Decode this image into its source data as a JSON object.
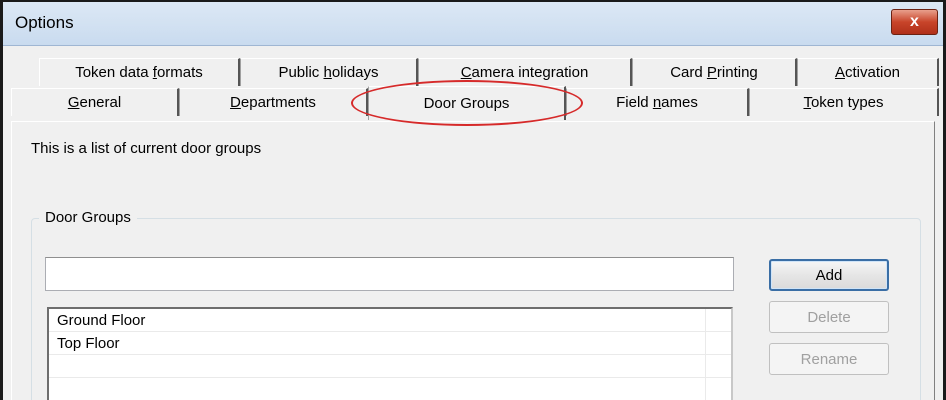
{
  "window": {
    "title": "Options",
    "close_glyph": "x"
  },
  "tabs_row1": [
    {
      "prefix": "Token data ",
      "mnemonic": "f",
      "suffix": "ormats"
    },
    {
      "prefix": "Public ",
      "mnemonic": "h",
      "suffix": "olidays"
    },
    {
      "prefix": "",
      "mnemonic": "C",
      "suffix": "amera integration"
    },
    {
      "prefix": "Card ",
      "mnemonic": "P",
      "suffix": "rinting"
    },
    {
      "prefix": "",
      "mnemonic": "A",
      "suffix": "ctivation"
    }
  ],
  "tabs_row2": [
    {
      "prefix": "",
      "mnemonic": "G",
      "suffix": "eneral"
    },
    {
      "prefix": "",
      "mnemonic": "D",
      "suffix": "epartments"
    },
    {
      "prefix": "Door Groups",
      "mnemonic": "",
      "suffix": ""
    },
    {
      "prefix": "Field ",
      "mnemonic": "n",
      "suffix": "ames"
    },
    {
      "prefix": "",
      "mnemonic": "T",
      "suffix": "oken types"
    }
  ],
  "content": {
    "description": "This is a list of current door groups",
    "group_label": "Door Groups",
    "name_input": {
      "value": "",
      "placeholder": ""
    },
    "list_items": [
      "Ground Floor",
      "Top Floor"
    ],
    "buttons": {
      "add": "Add",
      "delete": "Delete",
      "rename": "Rename"
    }
  },
  "colors": {
    "annotation": "#d62a2a",
    "close_button": "#c8442a"
  }
}
